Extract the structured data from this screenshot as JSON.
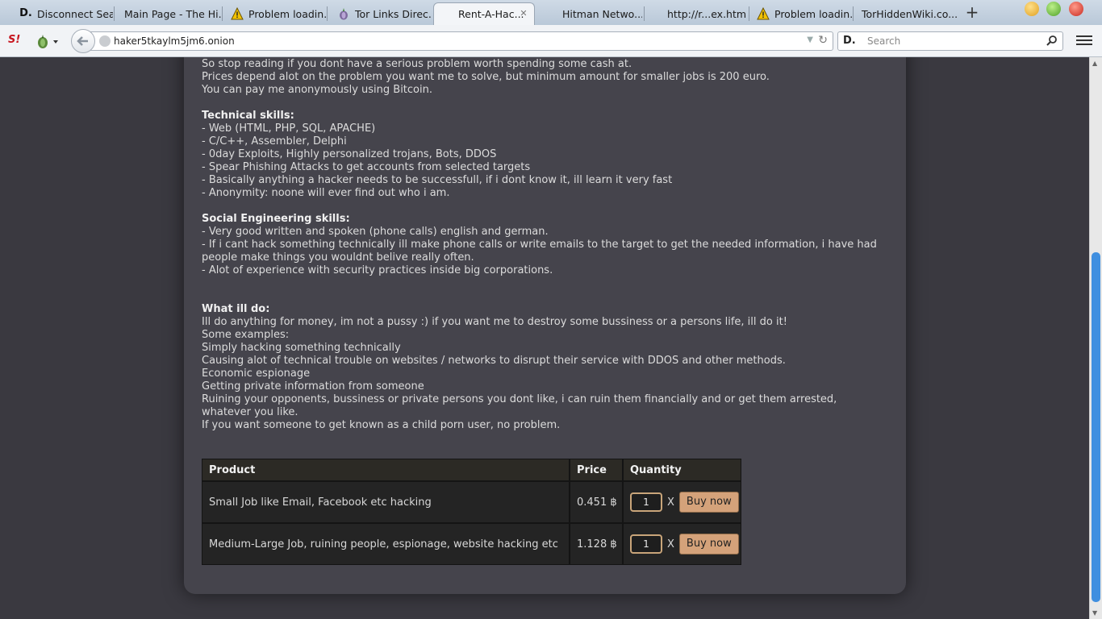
{
  "browser": {
    "tabs": [
      {
        "label": "Disconnect Sea...",
        "icon": "disconnect-icon"
      },
      {
        "label": "Main Page - The Hi...",
        "icon": "blank-icon"
      },
      {
        "label": "Problem loadin...",
        "icon": "warning-icon"
      },
      {
        "label": "Tor Links Direc...",
        "icon": "onion-icon"
      },
      {
        "label": "Rent-A-Hac...",
        "icon": "blank-icon",
        "active": true
      },
      {
        "label": "Hitman Netwo...",
        "icon": "blank-icon"
      },
      {
        "label": "http://r...ex.html",
        "icon": "blank-icon"
      },
      {
        "label": "Problem loadin...",
        "icon": "warning-icon"
      },
      {
        "label": "TorHiddenWiki.co...",
        "icon": "blank-icon"
      }
    ],
    "new_tab": "+",
    "close_tab": "✕",
    "url": "haker5tkaylm5jm6.onion",
    "search_logo": "D.",
    "search_placeholder": "Search",
    "accent_color": "#3f8fe0"
  },
  "page": {
    "intro_lines": [
      "So stop reading if you dont have a serious problem worth spending some cash at.",
      "Prices depend alot on the problem you want me to solve, but minimum amount for smaller jobs is 200 euro.",
      "You can pay me anonymously using Bitcoin."
    ],
    "technical": {
      "heading": "Technical skills:",
      "items": [
        "- Web (HTML, PHP, SQL, APACHE)",
        "- C/C++, Assembler, Delphi",
        "- 0day Exploits, Highly personalized trojans, Bots, DDOS",
        "- Spear Phishing Attacks to get accounts from selected targets",
        "- Basically anything a hacker needs to be successfull, if i dont know it, ill learn it very fast",
        "- Anonymity: noone will ever find out who i am."
      ]
    },
    "social": {
      "heading": "Social Engineering skills:",
      "items": [
        "- Very good written and spoken (phone calls) english and german.",
        "- If i cant hack something technically ill make phone calls or write emails to the target to get the needed information, i have had people make things you wouldnt belive really often.",
        "- Alot of experience with security practices inside big corporations."
      ]
    },
    "what": {
      "heading": "What ill do:",
      "items": [
        "Ill do anything for money, im not a pussy :) if you want me to destroy some bussiness or a persons life, ill do it!",
        "Some examples:",
        "Simply hacking something technically",
        "Causing alot of technical trouble on websites / networks to disrupt their service with DDOS and other methods.",
        "Economic espionage",
        "Getting private information from someone",
        "Ruining your opponents, bussiness or private persons you dont like, i can ruin them financially and or get them arrested, whatever you like.",
        "If you want someone to get known as a child porn user, no problem."
      ]
    },
    "table": {
      "headers": {
        "product": "Product",
        "price": "Price",
        "quantity": "Quantity"
      },
      "rows": [
        {
          "product": "Small Job like Email, Facebook etc hacking",
          "price": "0.451 ฿",
          "qty": "1",
          "times": "X",
          "buy": "Buy now"
        },
        {
          "product": "Medium-Large Job, ruining people, espionage, website hacking etc",
          "price": "1.128 ฿",
          "qty": "1",
          "times": "X",
          "buy": "Buy now"
        }
      ]
    }
  }
}
